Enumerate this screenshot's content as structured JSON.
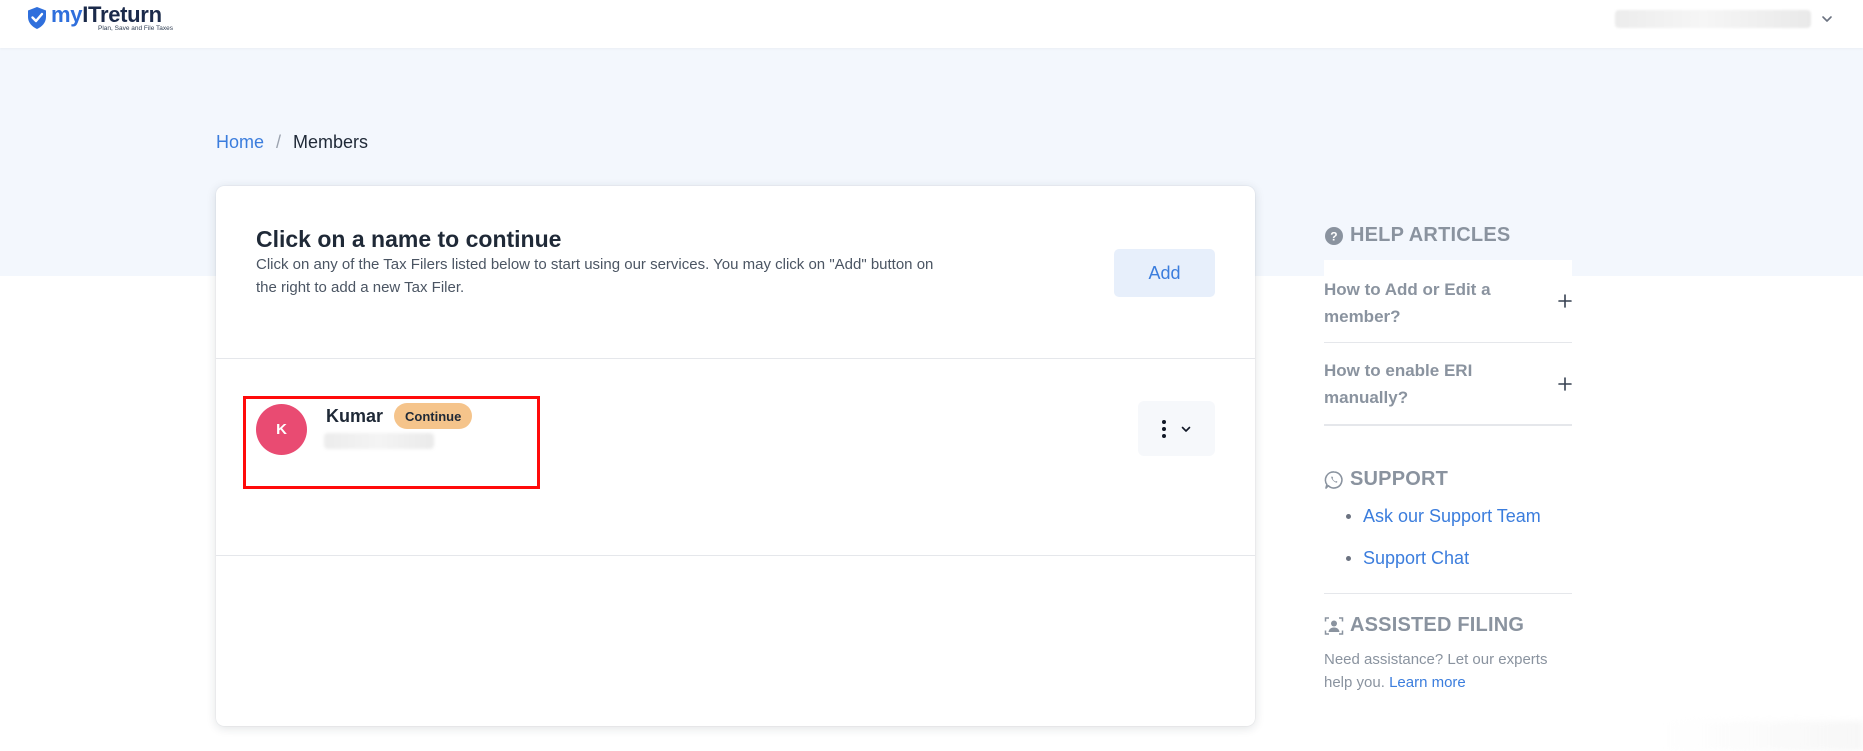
{
  "header": {
    "logo_prefix": "my",
    "logo_brand": "ITreturn",
    "logo_tagline": "Plan, Save and File Taxes"
  },
  "breadcrumb": {
    "home": "Home",
    "separator": "/",
    "current": "Members"
  },
  "main": {
    "title": "Click on a name to continue",
    "description": "Click on any of the Tax Filers listed below to start using our services. You may click on \"Add\" button on the right to add a new Tax Filer.",
    "add_label": "Add",
    "members": [
      {
        "initial": "K",
        "name": "Kumar",
        "badge": "Continue",
        "avatar_color": "#e94b72"
      }
    ]
  },
  "sidebar": {
    "help": {
      "title": "HELP ARTICLES",
      "articles": [
        {
          "label": "How to Add or Edit a member?"
        },
        {
          "label": "How to enable ERI manually?"
        }
      ]
    },
    "support": {
      "title": "SUPPORT",
      "links": [
        {
          "label": "Ask our Support Team"
        },
        {
          "label": "Support Chat"
        }
      ]
    },
    "assisted": {
      "title": "ASSISTED FILING",
      "text": "Need assistance? Let our experts help you.",
      "link": "Learn more"
    }
  },
  "colors": {
    "accent": "#3b7ddd",
    "band": "#f3f7fd",
    "badge": "#f5c48b",
    "highlight": "#ff0a0a",
    "muted": "#8a939f"
  },
  "icons": {
    "logo": "shield-check-icon",
    "user_menu": "chevron-down-icon",
    "help": "question-circle-icon",
    "faq_toggle": "plus-icon",
    "support": "whatsapp-icon",
    "assisted": "person-frame-icon",
    "row_menu": "vertical-dots-icon"
  }
}
